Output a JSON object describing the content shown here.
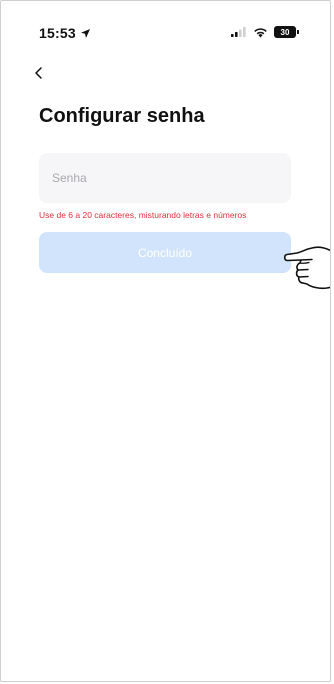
{
  "status_bar": {
    "time": "15:53",
    "battery_level": "30",
    "icons": [
      "location-arrow-icon",
      "cellular-signal-icon",
      "wifi-icon",
      "battery-icon"
    ]
  },
  "header": {
    "back_icon": "chevron-left-icon"
  },
  "main": {
    "title": "Configurar senha",
    "password_field": {
      "placeholder": "Senha",
      "value": ""
    },
    "hint": "Use de 6 a 20 caracteres, misturando letras e números",
    "done_button": {
      "label": "Concluído",
      "enabled": false
    }
  },
  "overlay": {
    "pointer_icon": "pointing-hand-icon"
  },
  "colors": {
    "hint_text": "#e0303a",
    "button_disabled_bg": "#d1e4fb",
    "field_bg": "#f6f6f8"
  }
}
